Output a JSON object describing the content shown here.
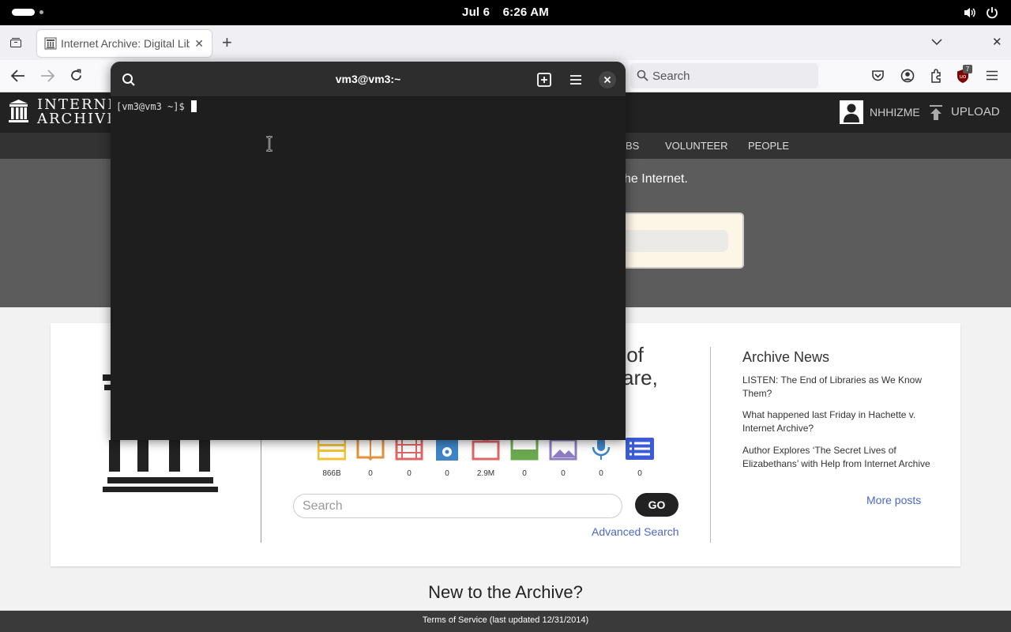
{
  "topbar": {
    "date": "Jul 6",
    "time": "6:26 AM"
  },
  "browser": {
    "tab_title": "Internet Archive: Digital Library of Free & Borrowable Books, Movies, Music & Wayback Machine",
    "search_placeholder": "Search",
    "extension_badge": "7"
  },
  "ia": {
    "logo_line1": "INTERNET",
    "logo_line2": "ARCHIVE",
    "username": "NHHIZME",
    "upload_label": "UPLOAD",
    "subnav": {
      "jobs_partial": "BS",
      "volunteer": "VOLUNTEER",
      "people": "PEOPLE"
    },
    "hero_partial": "he Internet.",
    "tagline_partial_1": "y of",
    "tagline_partial_2": "are,",
    "media_counts": [
      "866B",
      "0",
      "0",
      "0",
      "2.9M",
      "0",
      "0",
      "0",
      "0"
    ],
    "media_colors": [
      "#f1c232",
      "#e69138",
      "#e06666",
      "#3d85c6",
      "#e06666",
      "#6aa84f",
      "#8e7cc3",
      "#3d85c6",
      "#3c5bd6"
    ],
    "search_placeholder": "Search",
    "go_label": "GO",
    "advanced_search": "Advanced Search",
    "news_title": "Archive News",
    "news": [
      "LISTEN: The End of Libraries as We Know Them?",
      "What happened last Friday in Hachette v. Internet Archive?",
      "Author Explores ‘The Secret Lives of Elizabethans’ with Help from Internet Archive"
    ],
    "more_posts": "More posts",
    "new_to_archive": "New to the Archive?",
    "footer": "Terms of Service (last updated 12/31/2014)"
  },
  "terminal": {
    "title": "vm3@vm3:~",
    "prompt": "[vm3@vm3 ~]$"
  }
}
